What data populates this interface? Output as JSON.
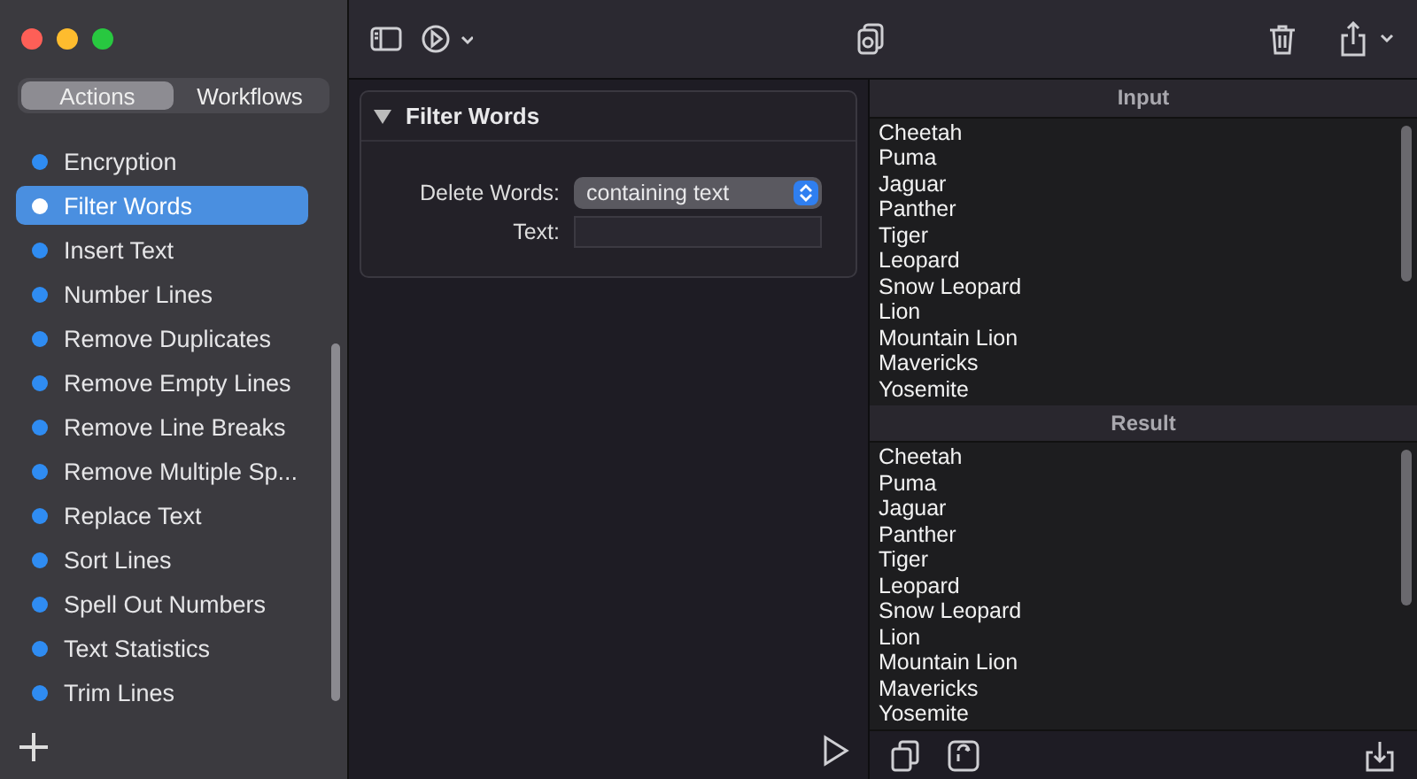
{
  "sidebar": {
    "tabs": [
      {
        "label": "Actions",
        "selected": true
      },
      {
        "label": "Workflows",
        "selected": false
      }
    ],
    "items": [
      {
        "label": "Encryption",
        "selected": false
      },
      {
        "label": "Filter Words",
        "selected": true
      },
      {
        "label": "Insert Text",
        "selected": false
      },
      {
        "label": "Number Lines",
        "selected": false
      },
      {
        "label": "Remove Duplicates",
        "selected": false
      },
      {
        "label": "Remove Empty Lines",
        "selected": false
      },
      {
        "label": "Remove Line Breaks",
        "selected": false
      },
      {
        "label": "Remove Multiple Sp...",
        "selected": false
      },
      {
        "label": "Replace Text",
        "selected": false
      },
      {
        "label": "Sort Lines",
        "selected": false
      },
      {
        "label": "Spell Out Numbers",
        "selected": false
      },
      {
        "label": "Text Statistics",
        "selected": false
      },
      {
        "label": "Trim Lines",
        "selected": false
      }
    ]
  },
  "action": {
    "title": "Filter Words",
    "expanded": true,
    "fields": [
      {
        "kind": "select",
        "label": "Delete Words:",
        "value": "containing text"
      },
      {
        "kind": "text",
        "label": "Text:"
      }
    ]
  },
  "panes": [
    {
      "title": "Input",
      "lines": [
        "Cheetah",
        "Puma",
        "Jaguar",
        "Panther",
        "Tiger",
        "Leopard",
        "Snow Leopard",
        "Lion",
        "Mountain Lion",
        "Mavericks",
        "Yosemite"
      ]
    },
    {
      "title": "Result",
      "lines": [
        "Cheetah",
        "Puma",
        "Jaguar",
        "Panther",
        "Tiger",
        "Leopard",
        "Snow Leopard",
        "Lion",
        "Mountain Lion",
        "Mavericks",
        "Yosemite"
      ]
    }
  ]
}
